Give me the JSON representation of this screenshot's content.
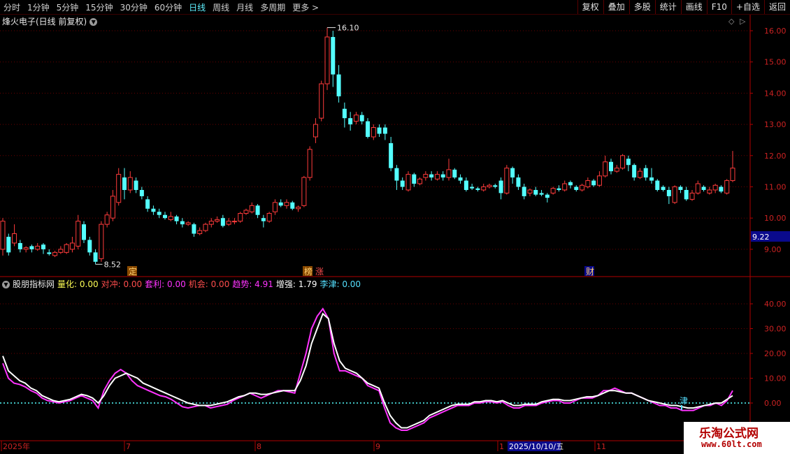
{
  "toolbar": {
    "timeframes": [
      "分时",
      "1分钟",
      "5分钟",
      "15分钟",
      "30分钟",
      "60分钟",
      "日线",
      "周线",
      "月线",
      "多周期",
      "更多 >"
    ],
    "active_index": 6,
    "right_buttons": [
      "复权",
      "叠加",
      "多股",
      "统计",
      "画线",
      "F10",
      "+自选",
      "返回"
    ]
  },
  "main_chart": {
    "title": "烽火电子(日线 前复权)",
    "price_axis": [
      "16.00",
      "15.00",
      "14.00",
      "13.00",
      "12.00",
      "11.00",
      "10.00",
      "9.00"
    ],
    "current_price_label": "9.22",
    "high_label": "16.10",
    "low_label": "8.52",
    "event_marks": [
      "定",
      "榜",
      "涨",
      "财"
    ],
    "colors": {
      "up": "#ff3b3b",
      "down": "#54ffff",
      "grid": "#6a0000",
      "current_label_bg": "#0a0a8c"
    }
  },
  "indicator": {
    "name": "股朋指标网",
    "fields": [
      {
        "label": "量化:",
        "value": "0.00",
        "color": "#ffff55"
      },
      {
        "label": "对冲:",
        "value": "0.00",
        "color": "#ff4d4d"
      },
      {
        "label": "套利:",
        "value": "0.00",
        "color": "#ff33ff"
      },
      {
        "label": "机会:",
        "value": "0.00",
        "color": "#ff4d4d"
      },
      {
        "label": "趋势:",
        "value": "4.91",
        "color": "#ff33ff"
      },
      {
        "label": "增强:",
        "value": "1.79",
        "color": "#ffffff"
      },
      {
        "label": "李津:",
        "value": "0.00",
        "color": "#55e0ff"
      }
    ],
    "axis": [
      "40.00",
      "30.00",
      "20.00",
      "10.00",
      "0.00"
    ],
    "mark": "津"
  },
  "date_axis": {
    "labels": [
      "2025年",
      "7",
      "8",
      "9",
      "1",
      "11"
    ],
    "highlight": "2025/10/10/五"
  },
  "watermark": {
    "line1": "乐淘公式网",
    "line2": "www.60lt.com"
  },
  "chart_data": {
    "type": "candlestick",
    "title": "",
    "ylim": [
      8.2,
      16.4
    ],
    "candles": [
      [
        9.0,
        9.9,
        8.8,
        10.0
      ],
      [
        9.4,
        8.9,
        8.8,
        9.5
      ],
      [
        9.2,
        9.5,
        9.1,
        9.8
      ],
      [
        9.2,
        9.0,
        8.9,
        9.3
      ],
      [
        9.0,
        9.05,
        8.9,
        9.1
      ],
      [
        9.1,
        9.0,
        8.9,
        9.15
      ],
      [
        9.0,
        9.1,
        8.95,
        9.2
      ],
      [
        9.15,
        9.0,
        8.85,
        9.2
      ],
      [
        8.9,
        8.85,
        8.8,
        9.0
      ],
      [
        8.8,
        8.9,
        8.75,
        8.95
      ],
      [
        8.9,
        9.0,
        8.85,
        9.1
      ],
      [
        8.9,
        9.15,
        8.85,
        9.2
      ],
      [
        9.0,
        9.2,
        8.9,
        9.4
      ],
      [
        9.1,
        9.9,
        9.0,
        10.1
      ],
      [
        9.8,
        9.3,
        9.2,
        9.9
      ],
      [
        9.3,
        8.9,
        8.8,
        9.4
      ],
      [
        8.9,
        8.6,
        8.52,
        9.0
      ],
      [
        8.7,
        9.8,
        8.6,
        9.9
      ],
      [
        9.8,
        10.1,
        9.7,
        10.2
      ],
      [
        10.0,
        10.7,
        9.9,
        10.9
      ],
      [
        10.5,
        11.4,
        10.4,
        11.6
      ],
      [
        11.3,
        10.9,
        10.6,
        11.6
      ],
      [
        10.9,
        11.3,
        10.8,
        11.5
      ],
      [
        11.2,
        10.9,
        10.8,
        11.3
      ],
      [
        10.9,
        10.7,
        10.6,
        11.0
      ],
      [
        10.6,
        10.3,
        10.2,
        10.7
      ],
      [
        10.3,
        10.2,
        10.1,
        10.4
      ],
      [
        10.2,
        10.1,
        10.0,
        10.3
      ],
      [
        10.1,
        10.0,
        9.95,
        10.2
      ],
      [
        9.95,
        10.05,
        9.9,
        10.2
      ],
      [
        10.05,
        9.9,
        9.8,
        10.1
      ],
      [
        9.9,
        9.8,
        9.7,
        10.0
      ],
      [
        9.8,
        9.85,
        9.75,
        9.9
      ],
      [
        9.8,
        9.5,
        9.4,
        9.85
      ],
      [
        9.5,
        9.6,
        9.45,
        9.7
      ],
      [
        9.6,
        9.8,
        9.55,
        9.85
      ],
      [
        9.8,
        9.9,
        9.7,
        10.0
      ],
      [
        9.9,
        9.95,
        9.85,
        10.05
      ],
      [
        10.0,
        9.75,
        9.7,
        10.1
      ],
      [
        9.8,
        9.9,
        9.75,
        10.0
      ],
      [
        9.9,
        9.9,
        9.8,
        10.0
      ],
      [
        9.9,
        10.15,
        9.85,
        10.2
      ],
      [
        10.15,
        10.25,
        10.1,
        10.3
      ],
      [
        10.2,
        10.4,
        10.15,
        10.5
      ],
      [
        10.4,
        10.1,
        10.0,
        10.45
      ],
      [
        10.0,
        9.9,
        9.7,
        10.1
      ],
      [
        9.9,
        10.15,
        9.85,
        10.2
      ],
      [
        10.2,
        10.5,
        10.1,
        10.6
      ],
      [
        10.5,
        10.4,
        10.35,
        10.6
      ],
      [
        10.4,
        10.5,
        10.3,
        10.6
      ],
      [
        10.5,
        10.3,
        10.25,
        10.55
      ],
      [
        10.3,
        10.35,
        10.2,
        10.4
      ],
      [
        10.4,
        11.3,
        10.35,
        11.35
      ],
      [
        11.3,
        12.2,
        11.2,
        12.3
      ],
      [
        12.6,
        13.0,
        12.4,
        13.2
      ],
      [
        13.2,
        14.3,
        13.1,
        14.4
      ],
      [
        14.3,
        15.8,
        14.1,
        16.1
      ],
      [
        15.8,
        14.6,
        14.2,
        16.0
      ],
      [
        14.6,
        13.9,
        13.7,
        14.9
      ],
      [
        13.5,
        13.2,
        12.9,
        13.7
      ],
      [
        13.2,
        13.0,
        12.8,
        13.4
      ],
      [
        13.1,
        13.3,
        13.0,
        13.4
      ],
      [
        13.3,
        13.1,
        13.0,
        13.4
      ],
      [
        13.1,
        12.6,
        12.55,
        13.2
      ],
      [
        12.6,
        12.9,
        12.5,
        13.0
      ],
      [
        12.9,
        12.7,
        12.6,
        13.0
      ],
      [
        12.9,
        12.7,
        12.5,
        13.0
      ],
      [
        12.4,
        11.6,
        11.5,
        12.6
      ],
      [
        11.6,
        11.2,
        10.9,
        11.7
      ],
      [
        11.2,
        11.0,
        10.9,
        11.3
      ],
      [
        10.9,
        11.4,
        10.85,
        11.5
      ],
      [
        11.4,
        11.1,
        11.0,
        11.45
      ],
      [
        11.1,
        11.25,
        11.05,
        11.3
      ],
      [
        11.3,
        11.4,
        11.2,
        11.5
      ],
      [
        11.4,
        11.3,
        11.2,
        11.5
      ],
      [
        11.25,
        11.4,
        11.2,
        11.5
      ],
      [
        11.4,
        11.3,
        11.2,
        11.5
      ],
      [
        11.3,
        11.55,
        11.2,
        11.9
      ],
      [
        11.55,
        11.3,
        11.25,
        11.6
      ],
      [
        11.3,
        11.2,
        11.1,
        11.4
      ],
      [
        11.2,
        10.9,
        10.85,
        11.3
      ],
      [
        11.0,
        10.95,
        10.9,
        11.1
      ],
      [
        10.95,
        10.9,
        10.85,
        11.0
      ],
      [
        10.9,
        11.0,
        10.85,
        11.1
      ],
      [
        11.0,
        11.05,
        10.95,
        11.1
      ],
      [
        11.05,
        11.0,
        10.95,
        11.1
      ],
      [
        11.2,
        10.8,
        10.6,
        11.3
      ],
      [
        10.8,
        11.6,
        10.75,
        11.7
      ],
      [
        11.6,
        11.3,
        11.1,
        11.65
      ],
      [
        11.3,
        11.0,
        10.9,
        11.4
      ],
      [
        11.0,
        10.7,
        10.6,
        11.1
      ],
      [
        10.8,
        10.9,
        10.7,
        10.95
      ],
      [
        10.9,
        10.75,
        10.7,
        11.0
      ],
      [
        10.8,
        10.75,
        10.7,
        10.9
      ],
      [
        10.75,
        10.65,
        10.5,
        10.8
      ],
      [
        10.8,
        10.95,
        10.75,
        11.0
      ],
      [
        10.95,
        10.9,
        10.85,
        11.05
      ],
      [
        10.9,
        11.1,
        10.85,
        11.2
      ],
      [
        11.15,
        11.05,
        10.95,
        11.2
      ],
      [
        11.0,
        10.9,
        10.85,
        11.05
      ],
      [
        10.9,
        11.05,
        10.85,
        11.1
      ],
      [
        11.0,
        11.2,
        10.95,
        11.3
      ],
      [
        11.2,
        11.05,
        11.0,
        11.25
      ],
      [
        11.05,
        11.35,
        11.0,
        11.5
      ],
      [
        11.35,
        11.8,
        11.3,
        12.0
      ],
      [
        11.8,
        11.5,
        11.4,
        11.9
      ],
      [
        11.5,
        11.6,
        11.45,
        11.7
      ],
      [
        11.6,
        12.0,
        11.55,
        12.05
      ],
      [
        11.9,
        11.7,
        11.5,
        12.0
      ],
      [
        11.7,
        11.3,
        11.2,
        11.75
      ],
      [
        11.3,
        11.5,
        11.25,
        11.6
      ],
      [
        11.6,
        11.3,
        11.2,
        11.7
      ],
      [
        11.3,
        11.2,
        11.1,
        11.6
      ],
      [
        11.2,
        10.9,
        10.85,
        11.25
      ],
      [
        11.0,
        10.9,
        10.85,
        11.05
      ],
      [
        10.9,
        10.7,
        10.45,
        11.0
      ],
      [
        10.5,
        11.0,
        10.45,
        11.05
      ],
      [
        11.0,
        10.9,
        10.8,
        11.05
      ],
      [
        10.9,
        10.6,
        10.55,
        11.0
      ],
      [
        10.6,
        10.8,
        10.55,
        10.9
      ],
      [
        10.8,
        11.1,
        10.75,
        11.2
      ],
      [
        11.0,
        10.9,
        10.85,
        11.05
      ],
      [
        10.8,
        10.9,
        10.75,
        11.0
      ],
      [
        10.9,
        11.05,
        10.8,
        11.1
      ],
      [
        11.0,
        10.85,
        10.8,
        11.05
      ],
      [
        10.8,
        11.2,
        10.75,
        11.25
      ],
      [
        11.2,
        11.6,
        11.15,
        12.15
      ]
    ],
    "indicator_series": [
      {
        "values": [
          16,
          10,
          8,
          7.5,
          6.5,
          5,
          4,
          2,
          1,
          0.5,
          0,
          0.5,
          1,
          2,
          3,
          2,
          1,
          -2,
          5,
          9,
          12,
          13.5,
          12,
          9,
          7,
          6,
          5,
          4,
          3,
          2.5,
          1.5,
          0,
          -1.5,
          -2,
          -1.5,
          -1,
          -1,
          -2,
          -1.5,
          -1,
          -0.5,
          1,
          2,
          3,
          4,
          3,
          2,
          3,
          4,
          5,
          5,
          4.5,
          4,
          12,
          20,
          30,
          35,
          38,
          34,
          20,
          13,
          13,
          12,
          11,
          10,
          7,
          6,
          5,
          -2,
          -8,
          -10,
          -11,
          -11,
          -10,
          -9,
          -8,
          -6,
          -5,
          -4,
          -3,
          -2,
          -1,
          -1,
          -1,
          0,
          0,
          0.5,
          0.5,
          0,
          0.5,
          -1,
          -2,
          -2,
          -1,
          -1,
          -1,
          0,
          0.5,
          1,
          1,
          0,
          0,
          1,
          2,
          2,
          2,
          3,
          5,
          5,
          6,
          5,
          4,
          4,
          3,
          2,
          1,
          0,
          -1,
          -1,
          -2,
          -2,
          -3,
          -3,
          -3,
          -2,
          -1,
          -1,
          0,
          -1,
          1,
          5
        ]
      },
      {
        "values": [
          19,
          13,
          11,
          9,
          8,
          6,
          5,
          3,
          2,
          1,
          0.5,
          1,
          1.5,
          2.5,
          3.5,
          3,
          2,
          0,
          3,
          7,
          10,
          11,
          12,
          11,
          10,
          8,
          7,
          6,
          5,
          4,
          3,
          2,
          1,
          0,
          -0.5,
          -1,
          -1,
          -1,
          -0.5,
          0,
          0.5,
          1.5,
          2.5,
          3,
          4,
          4,
          3.5,
          3.5,
          4,
          4.5,
          5,
          5,
          5,
          9,
          15,
          24,
          30,
          36,
          34,
          24,
          17,
          14,
          13,
          12,
          10,
          8,
          7,
          6,
          0,
          -5,
          -8,
          -10,
          -10,
          -9,
          -8,
          -7,
          -5,
          -4,
          -3,
          -2,
          -1,
          -0.5,
          -0.5,
          -0.5,
          0.5,
          0.5,
          1,
          1,
          0.5,
          1,
          0,
          -1,
          -1,
          -0.5,
          -0.5,
          -0.5,
          0.5,
          1,
          1.5,
          1.5,
          1,
          1,
          1.5,
          2,
          2.5,
          2.5,
          3,
          4,
          5,
          5,
          4.5,
          4,
          4,
          3,
          2,
          1,
          0.5,
          0,
          -0.5,
          -1,
          -1,
          -1.5,
          -2,
          -2,
          -1.5,
          -1,
          -0.5,
          0,
          0,
          1.5,
          3
        ]
      }
    ],
    "indicator_ylim": [
      -15,
      48
    ]
  }
}
